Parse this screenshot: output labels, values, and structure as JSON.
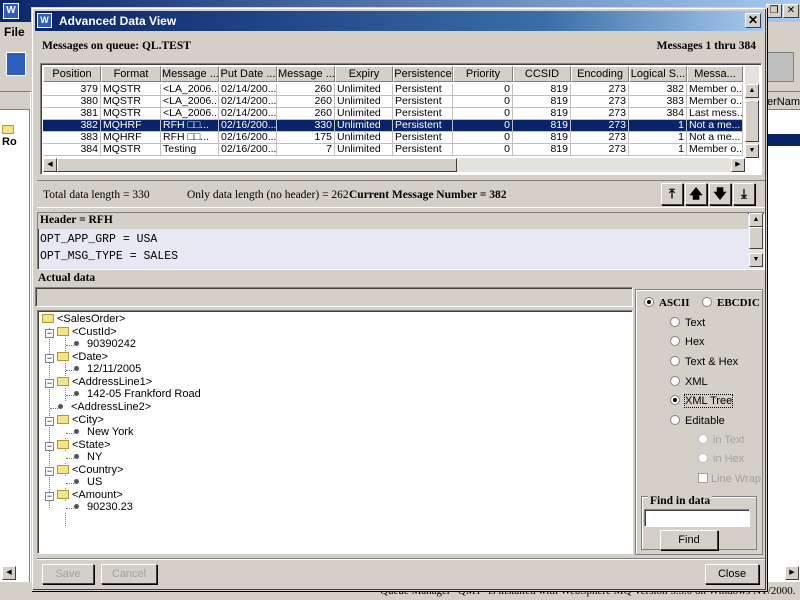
{
  "background_app": {
    "title_initial": "W",
    "menu_file": "File",
    "tree_root": "Ro",
    "right_column_header": "erNam",
    "status_text": "Queue Manager \"QM1\" is installed with WebSphere MQ Version 5.3.0 on Windows NT/2000."
  },
  "dialog": {
    "title": "Advanced Data View",
    "close_glyph": "✕"
  },
  "queue": {
    "label": "Messages on queue: QL.TEST",
    "range": "Messages 1 thru 384"
  },
  "table": {
    "columns": [
      "Position",
      "Format",
      "Message ...",
      "Put Date ...",
      "Message ...",
      "Expiry",
      "Persistence",
      "Priority",
      "CCSID",
      "Encoding",
      "Logical S...",
      "Messa..."
    ],
    "rows": [
      [
        "379",
        "MQSTR",
        "<LA_2006...",
        "02/14/200...",
        "260",
        "Unlimited",
        "Persistent",
        "0",
        "819",
        "273",
        "382",
        "Member o..."
      ],
      [
        "380",
        "MQSTR",
        "<LA_2006...",
        "02/14/200...",
        "260",
        "Unlimited",
        "Persistent",
        "0",
        "819",
        "273",
        "383",
        "Member o..."
      ],
      [
        "381",
        "MQSTR",
        "<LA_2006...",
        "02/14/200...",
        "260",
        "Unlimited",
        "Persistent",
        "0",
        "819",
        "273",
        "384",
        "Last mess..."
      ],
      [
        "382",
        "MQHRF",
        "RFH □□...",
        "02/16/200...",
        "330",
        "Unlimited",
        "Persistent",
        "0",
        "819",
        "273",
        "1",
        "Not a me..."
      ],
      [
        "383",
        "MQHRF",
        "RFH □□...",
        "02/16/200...",
        "175",
        "Unlimited",
        "Persistent",
        "0",
        "819",
        "273",
        "1",
        "Not a me..."
      ],
      [
        "384",
        "MQSTR",
        "Testing",
        "02/16/200...",
        "7",
        "Unlimited",
        "Persistent",
        "0",
        "819",
        "273",
        "1",
        "Member o..."
      ]
    ],
    "selected_row": 3
  },
  "summary": {
    "total_length": "Total data length = 330",
    "data_length": "Only data length (no header) = 262",
    "current_message": "Current Message Number = 382"
  },
  "header_panel": {
    "title": "Header = RFH",
    "line1": "OPT_APP_GRP = USA",
    "line2": "OPT_MSG_TYPE = SALES"
  },
  "actual_data": {
    "label": "Actual data",
    "input_value": "",
    "tree": {
      "root": "<SalesOrder>",
      "custid": "<CustId>",
      "custid_val": "90390242",
      "date": "<Date>",
      "date_val": "12/11/2005",
      "addr1": "<AddressLine1>",
      "addr1_val": "142-05 Frankford Road",
      "addr2": "<AddressLine2>",
      "city": "<City>",
      "city_val": "New York",
      "state": "<State>",
      "state_val": "NY",
      "country": "<Country>",
      "country_val": "US",
      "amount": "<Amount>",
      "amount_val": "90230.23"
    }
  },
  "options": {
    "ascii": "ASCII",
    "ebcdic": "EBCDIC",
    "text": "Text",
    "hex": "Hex",
    "text_hex": "Text & Hex",
    "xml": "XML",
    "xml_tree": "XML Tree",
    "editable": "Editable",
    "in_text": "in Text",
    "in_hex": "in Hex",
    "line_wrap": "Line Wrap",
    "selected_encoding": "ASCII",
    "selected_view": "XML Tree"
  },
  "find": {
    "label": "Find in data",
    "input_value": "",
    "button": "Find"
  },
  "footer": {
    "save": "Save",
    "cancel": "Cancel",
    "close": "Close"
  }
}
